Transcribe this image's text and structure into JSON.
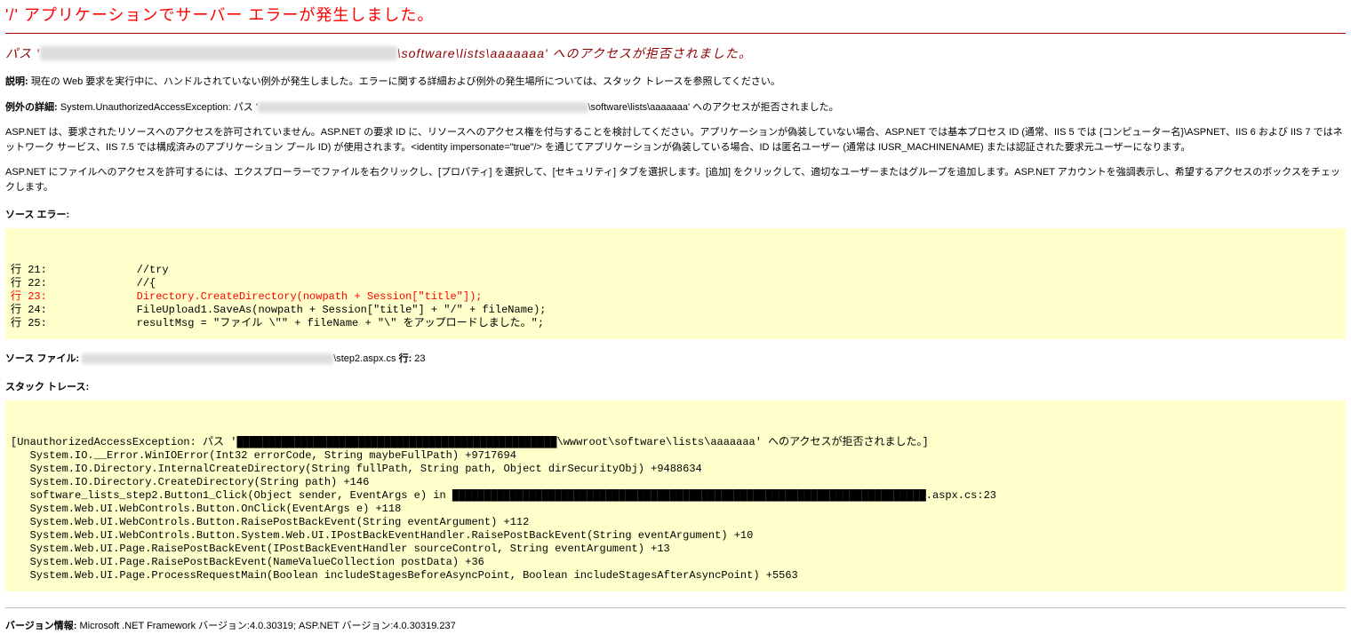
{
  "title": "'/' アプリケーションでサーバー エラーが発生しました。",
  "subtitle": {
    "prefix": "パス '",
    "redacted": "x:\\xxxx\\xxxxxxx\\xxxxx\\xxxxxxxxxx\\xxxxxxxxx\\xxxxxxxxxx",
    "visible": "\\software\\lists\\aaaaaaa' へのアクセスが拒否されました。"
  },
  "description": {
    "label": "説明: ",
    "text": "現在の Web 要求を実行中に、ハンドルされていない例外が発生しました。エラーに関する詳細および例外の発生場所については、スタック トレースを参照してください。"
  },
  "exception_details": {
    "label": "例外の詳細: ",
    "prefix": "System.UnauthorizedAccessException: パス '",
    "redacted": "x:xxxxxxxxxxxxxxxxxxxxxxxxxxxxxxxxxxxxxxxxxxxxxxxxxxxxxxxxxxxxxxxxxx",
    "suffix": "\\software\\lists\\aaaaaaa' へのアクセスが拒否されました。"
  },
  "explain1": "ASP.NET は、要求されたリソースへのアクセスを許可されていません。ASP.NET の要求 ID に、リソースへのアクセス権を付与することを検討してください。アプリケーションが偽装していない場合、ASP.NET では基本プロセス ID (通常、IIS 5 では {コンピューター名}\\ASPNET、IIS 6 および IIS 7 ではネットワーク サービス、IIS 7.5 では構成済みのアプリケーション プール ID) が使用されます。<identity impersonate=\"true\"/> を通じてアプリケーションが偽装している場合、ID は匿名ユーザー (通常は IUSR_MACHINENAME) または認証された要求元ユーザーになります。",
  "explain2": "ASP.NET にファイルへのアクセスを許可するには、エクスプローラーでファイルを右クリックし、[プロパティ] を選択して、[セキュリティ] タブを選択します。[追加] をクリックして、適切なユーザーまたはグループを追加します。ASP.NET アカウントを強調表示し、希望するアクセスのボックスをチェックします。",
  "source_error": {
    "label": "ソース エラー:",
    "lines": [
      {
        "n": "行 21:",
        "code": "        //try"
      },
      {
        "n": "行 22:",
        "code": "        //{"
      },
      {
        "n": "行 23:",
        "code": "        Directory.CreateDirectory(nowpath + Session[\"title\"]);",
        "highlight": true
      },
      {
        "n": "行 24:",
        "code": "        FileUpload1.SaveAs(nowpath + Session[\"title\"] + \"/\" + fileName);"
      },
      {
        "n": "行 25:",
        "code": "        resultMsg = \"ファイル \\\"\" + fileName + \"\\\" をアップロードしました。\";"
      }
    ]
  },
  "source_file": {
    "label": "ソース ファイル: ",
    "redacted": "x:\\xxxx\\xxxxxxx\\xxxxx\\xxxxxxxxxx\\xxx\\xxxxxxxx\\xxxxxxxxx",
    "visible": "\\step2.aspx.cs",
    "line_label": "    行: ",
    "line_no": "23"
  },
  "stack_trace": {
    "label": "スタック トレース:",
    "lines": [
      "[UnauthorizedAccessException: パス '██████████████████████████████████████████████████\\wwwroot\\software\\lists\\aaaaaaa' へのアクセスが拒否されました。]",
      "   System.IO.__Error.WinIOError(Int32 errorCode, String maybeFullPath) +9717694",
      "   System.IO.Directory.InternalCreateDirectory(String fullPath, String path, Object dirSecurityObj) +9488634",
      "   System.IO.Directory.CreateDirectory(String path) +146",
      "   software_lists_step2.Button1_Click(Object sender, EventArgs e) in ██████████████████████████████████████████████████████████████████████████.aspx.cs:23",
      "   System.Web.UI.WebControls.Button.OnClick(EventArgs e) +118",
      "   System.Web.UI.WebControls.Button.RaisePostBackEvent(String eventArgument) +112",
      "   System.Web.UI.WebControls.Button.System.Web.UI.IPostBackEventHandler.RaisePostBackEvent(String eventArgument) +10",
      "   System.Web.UI.Page.RaisePostBackEvent(IPostBackEventHandler sourceControl, String eventArgument) +13",
      "   System.Web.UI.Page.RaisePostBackEvent(NameValueCollection postData) +36",
      "   System.Web.UI.Page.ProcessRequestMain(Boolean includeStagesBeforeAsyncPoint, Boolean includeStagesAfterAsyncPoint) +5563"
    ]
  },
  "version": {
    "label": "バージョン情報: ",
    "text": "Microsoft .NET Framework バージョン:4.0.30319; ASP.NET バージョン:4.0.30319.237"
  }
}
